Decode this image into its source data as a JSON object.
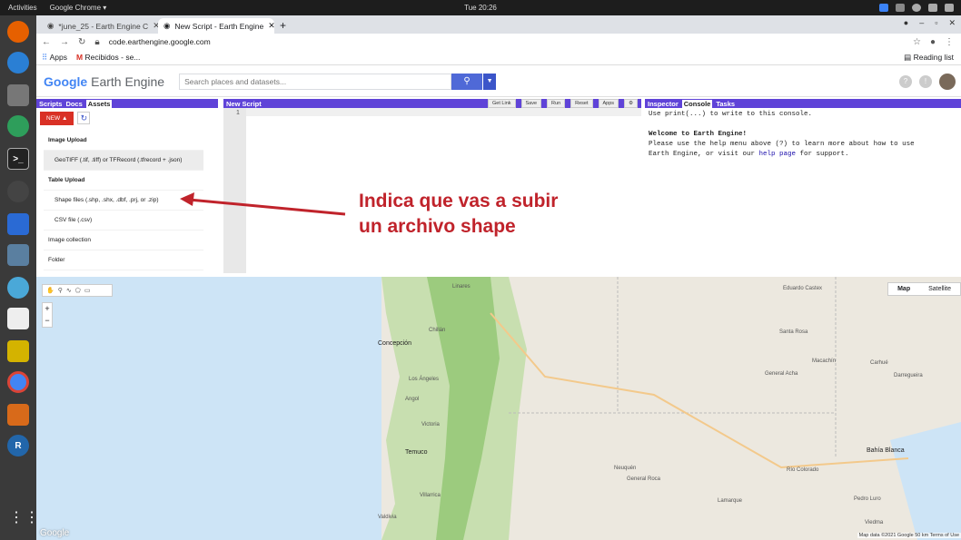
{
  "system": {
    "activities": "Activities",
    "app": "Google Chrome ▾",
    "clock": "Tue 20:26"
  },
  "browser": {
    "tabs": [
      {
        "label": "*june_25 - Earth Engine C",
        "active": false
      },
      {
        "label": "New Script - Earth Engine",
        "active": true
      }
    ],
    "url": "code.earthengine.google.com",
    "bookmarks": [
      {
        "label": "Apps"
      },
      {
        "label": "Recibidos - se..."
      }
    ],
    "reading_list": "Reading list"
  },
  "header": {
    "logo_google": "Google",
    "logo_rest": " Earth Engine",
    "search_placeholder": "Search places and datasets..."
  },
  "left_panel": {
    "tabs": [
      "Scripts",
      "Docs",
      "Assets"
    ],
    "new_button": "NEW ▲",
    "items": [
      {
        "label": "Image Upload",
        "kind": "header"
      },
      {
        "label": "GeoTIFF (.tif, .tiff) or TFRecord (.tfrecord + .json)",
        "kind": "sub",
        "highlight": true
      },
      {
        "label": "Table Upload",
        "kind": "header"
      },
      {
        "label": "Shape files (.shp, .shx, .dbf, .prj, or .zip)",
        "kind": "sub"
      },
      {
        "label": "CSV file (.csv)",
        "kind": "sub"
      },
      {
        "label": "Image collection",
        "kind": "plain"
      },
      {
        "label": "Folder",
        "kind": "plain"
      }
    ]
  },
  "editor": {
    "title": "New Script",
    "buttons": [
      "Get Link",
      "Save",
      "Run",
      "Reset",
      "Apps"
    ],
    "line_number": "1"
  },
  "right_panel": {
    "tabs": [
      "Inspector",
      "Console",
      "Tasks"
    ],
    "console_line1": "Use print(...) to write to this console.",
    "welcome": "Welcome to Earth Engine!",
    "line_a": "Please use the help menu above (",
    "line_a2": ") to learn more about how to use",
    "line_b": "Earth Engine, or visit our ",
    "help_link": "help page",
    "line_b2": " for support."
  },
  "map": {
    "type_map": "Map",
    "type_sat": "Satellite",
    "labels": [
      {
        "text": "Linares"
      },
      {
        "text": "Chillán"
      },
      {
        "text": "Concepción"
      },
      {
        "text": "Los Ángeles"
      },
      {
        "text": "Temuco"
      },
      {
        "text": "Villarrica"
      },
      {
        "text": "Valdivia"
      },
      {
        "text": "Santa Rosa"
      },
      {
        "text": "Bahía Blanca"
      },
      {
        "text": "General Roca"
      },
      {
        "text": "Neuquén"
      },
      {
        "text": "Victoria"
      },
      {
        "text": "Angol"
      },
      {
        "text": "Río Colorado"
      },
      {
        "text": "Eduardo Castex"
      },
      {
        "text": "Macachín"
      },
      {
        "text": "General Acha"
      },
      {
        "text": "Carhué"
      },
      {
        "text": "Darregueira"
      },
      {
        "text": "Pedro Luro"
      },
      {
        "text": "Viedma"
      },
      {
        "text": "Lamarque"
      }
    ],
    "attribution": "Map data ©2021 Google  50 km  Terms of Use",
    "google": "Google"
  },
  "annotation": {
    "line1": "Indica que vas a subir",
    "line2": "un archivo shape"
  },
  "colors": {
    "accent": "#5f43d8",
    "annotation": "#c0232b",
    "new_button": "#d93025"
  }
}
